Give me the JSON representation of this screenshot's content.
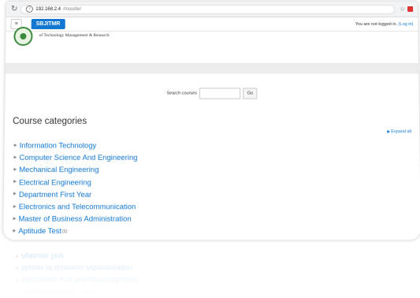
{
  "browser": {
    "url_host": "192.168.2.4",
    "url_path": "/moodle/"
  },
  "navbar": {
    "brand": "SBJITMR",
    "login_text": "You are not logged in.",
    "login_link": "(Log in)"
  },
  "header": {
    "org_text": "of Technology Management & Research"
  },
  "search": {
    "label": "Search courses",
    "value": "",
    "go_label": "Go"
  },
  "categories": {
    "title": "Course categories",
    "expand_all": "Expand all",
    "items": [
      {
        "label": "Information Technology",
        "count": ""
      },
      {
        "label": "Computer Science And Engineering",
        "count": ""
      },
      {
        "label": "Mechanical Engineering",
        "count": ""
      },
      {
        "label": "Electrical Engineering",
        "count": ""
      },
      {
        "label": "Department First Year",
        "count": ""
      },
      {
        "label": "Electronics and Telecommunication",
        "count": ""
      },
      {
        "label": "Master of Business Administration",
        "count": ""
      },
      {
        "label": "Aptitude Test",
        "count": "(1)"
      }
    ]
  },
  "colors": {
    "accent": "#1177d1",
    "brand_bg": "#1177d1"
  }
}
